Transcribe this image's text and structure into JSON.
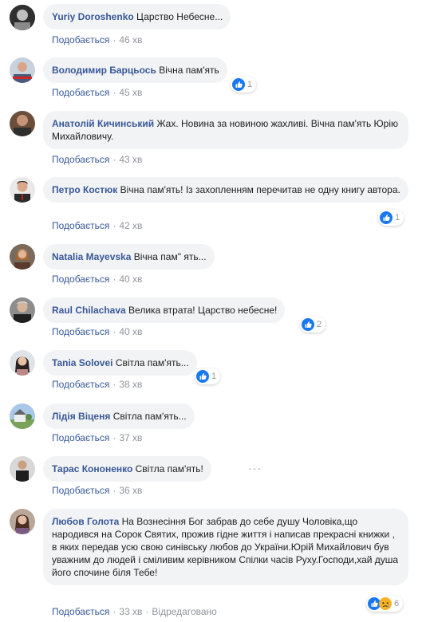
{
  "like_label": "Подобається",
  "comments": [
    {
      "name": "Yuriy Doroshenko",
      "text": "Царство Небесне...",
      "time": "46 хв",
      "reactions": null
    },
    {
      "name": "Володимир Барцьось",
      "text": "Вічна пам'ять",
      "time": "45 хв",
      "reactions": "1"
    },
    {
      "name": "Анатолій Кичинський",
      "text": "Жах. Новина за новиною жахливі. Вічна пам'ять Юрію Михайловичу.",
      "time": "43 хв",
      "reactions": null
    },
    {
      "name": "Петро Костюк",
      "text": "Вічна пам'ять! Із захопленням перечитав не одну книгу автора.",
      "time": "42 хв",
      "reactions": "1"
    },
    {
      "name": "Natalia Mayevska",
      "text": "Вічна пам\" ять...",
      "time": "40 хв",
      "reactions": null
    },
    {
      "name": "Raul Chilachava",
      "text": "Велика втрата! Царство небесне!",
      "time": "40 хв",
      "reactions": "2"
    },
    {
      "name": "Tania Solovei",
      "text": "Світла пам'ять...",
      "time": "38 хв",
      "reactions": "1"
    },
    {
      "name": "Лідія Віценя",
      "text": "Світла пам'ять...",
      "time": "37 хв",
      "reactions": null
    },
    {
      "name": "Тарас Кононенко",
      "text": "Світла пам'ять!",
      "time": "36 хв",
      "reactions": null
    },
    {
      "name": "Любов Голота",
      "text": "На Вознесіння Бог забрав до себе душу Чоловіка,що народився на Сорок Святих, прожив гідне життя і написав прекрасні книжки , в яких передав усю свою синівську любов до України.Юрій Михайлович був уважним до людей і сміливим керівником Спілки часів Руху.Господи,хай душа його спочине біля Тебе!",
      "time": "33 хв",
      "edited": "Відредаговано",
      "reactions": "6"
    }
  ],
  "more_glyph": "···",
  "colors": {
    "link": "#385898",
    "bubble": "#f2f3f5",
    "meta": "#90949c",
    "like_blue": "#1877f2",
    "sad_yellow": "#f7b125"
  }
}
